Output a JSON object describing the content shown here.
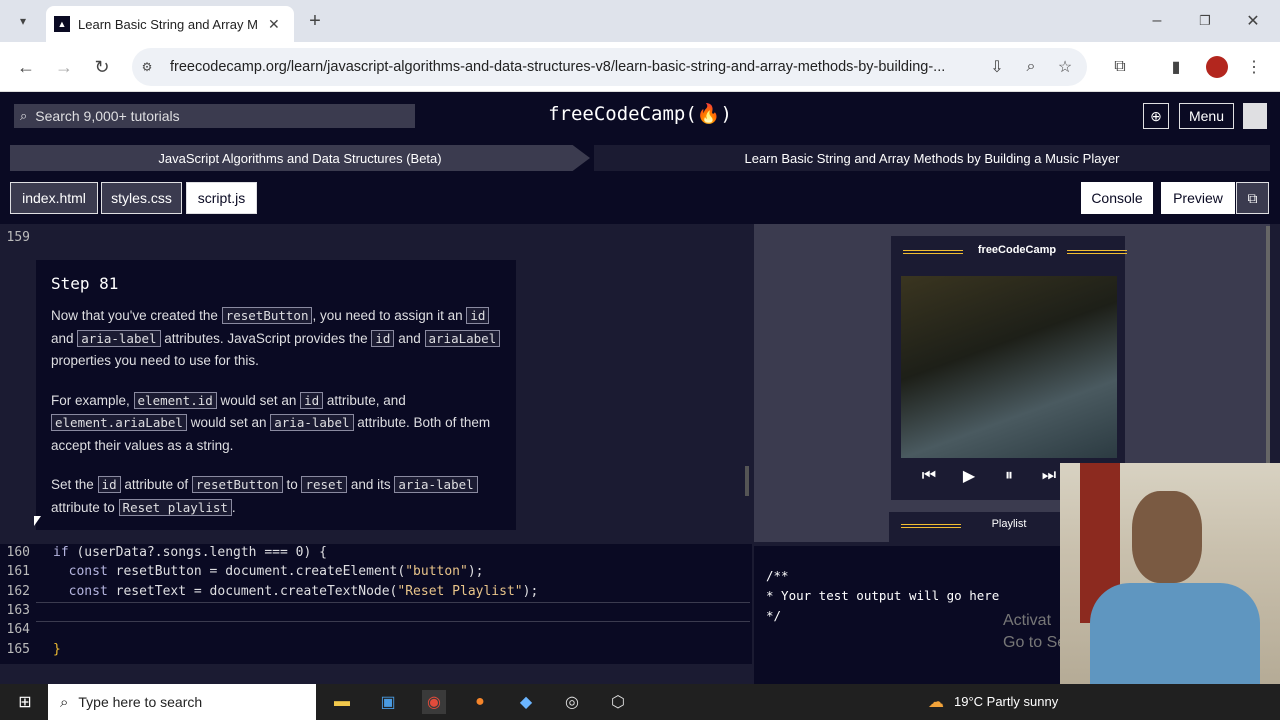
{
  "browser": {
    "tab_title": "Learn Basic String and Array Met",
    "url": "freecodecamp.org/learn/javascript-algorithms-and-data-structures-v8/learn-basic-string-and-array-methods-by-building-..."
  },
  "nav": {
    "search_placeholder": "Search 9,000+ tutorials",
    "logo": "freeCodeCamp(🔥)",
    "menu_label": "Menu"
  },
  "breadcrumb": {
    "superblock": "JavaScript Algorithms and Data Structures (Beta)",
    "block": "Learn Basic String and Array Methods by Building a Music Player"
  },
  "file_tabs": [
    "index.html",
    "styles.css",
    "script.js"
  ],
  "right_buttons": {
    "console": "Console",
    "preview": "Preview"
  },
  "editor": {
    "line_top": "159",
    "lines": [
      {
        "n": "160",
        "kw": "if",
        "rest": " (userData?.songs.length === 0) {"
      },
      {
        "n": "161",
        "kw": "  const",
        "rest": " resetButton = document.createElement(",
        "str": "\"button\"",
        "end": ");"
      },
      {
        "n": "162",
        "kw": "  const",
        "rest": " resetText = document.createTextNode(",
        "str": "\"Reset Playlist\"",
        "end": ");"
      },
      {
        "n": "163"
      },
      {
        "n": "164"
      },
      {
        "n": "165",
        "rest": "}"
      }
    ]
  },
  "step": {
    "title": "Step 81",
    "p1": [
      "Now that you've created the ",
      "resetButton",
      ", you need to assign it an ",
      "id",
      " and ",
      "aria-label",
      " attributes. JavaScript provides the ",
      "id",
      " and ",
      "ariaLabel",
      " properties you need to use for this."
    ],
    "p2": [
      "For example, ",
      "element.id",
      " would set an ",
      "id",
      " attribute, and ",
      "element.ariaLabel",
      " would set an ",
      "aria-label",
      " attribute. Both of them accept their values as a string."
    ],
    "p3": [
      "Set the ",
      "id",
      " attribute of ",
      "resetButton",
      " to ",
      "reset",
      " and its ",
      "aria-label",
      " attribute to ",
      "Reset playlist",
      "."
    ]
  },
  "preview": {
    "player_title": "freeCodeCamp",
    "playlist_title": "Playlist"
  },
  "console_text": "/**\n* Your test output will go here\n*/",
  "watermark": "Activat\nGo to Set",
  "taskbar": {
    "search": "Type here to search",
    "weather": "19°C  Partly sunny"
  },
  "colors": {
    "bg": "#1b1b32",
    "nav": "#0a0a23",
    "accent": "#f1be32"
  }
}
